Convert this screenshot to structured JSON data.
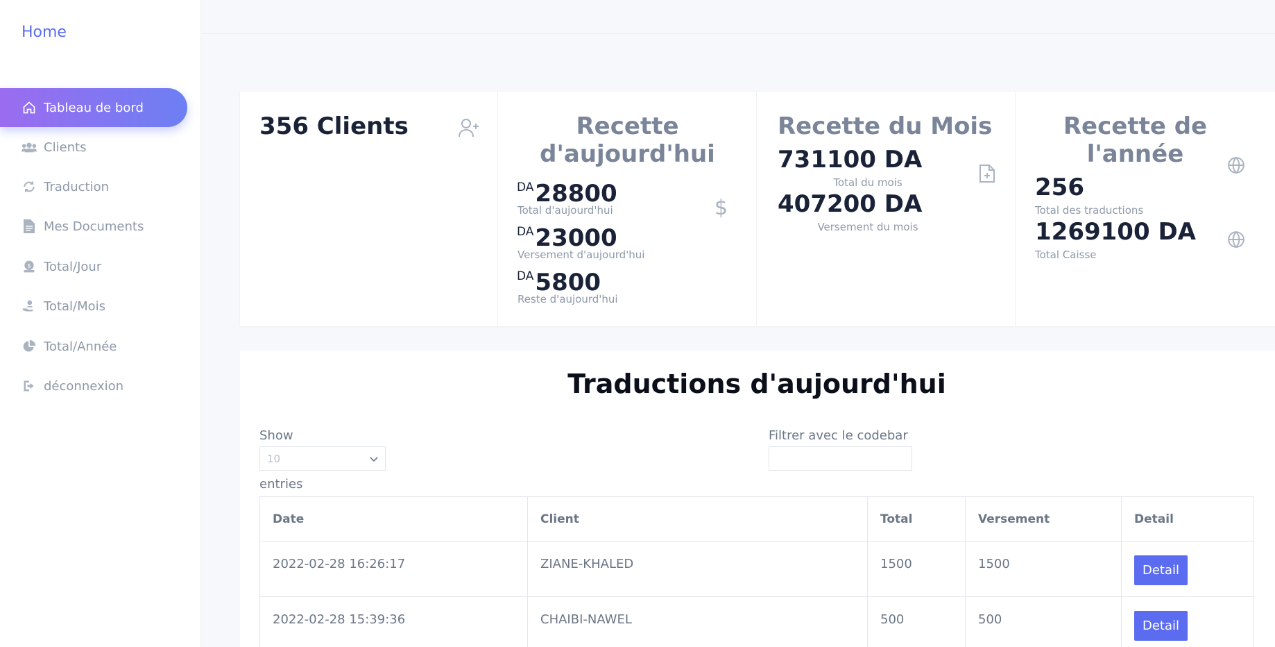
{
  "sidebar": {
    "brand": "Home",
    "items": [
      {
        "label": "Tableau de bord",
        "icon": "home-icon",
        "active": true
      },
      {
        "label": "Clients",
        "icon": "users-icon",
        "active": false
      },
      {
        "label": "Traduction",
        "icon": "refresh-icon",
        "active": false
      },
      {
        "label": "Mes Documents",
        "icon": "document-icon",
        "active": false
      },
      {
        "label": "Total/Jour",
        "icon": "money-icon",
        "active": false
      },
      {
        "label": "Total/Mois",
        "icon": "hand-coin-icon",
        "active": false
      },
      {
        "label": "Total/Année",
        "icon": "pie-chart-icon",
        "active": false
      },
      {
        "label": "déconnexion",
        "icon": "logout-icon",
        "active": false
      }
    ]
  },
  "stats": {
    "clients": {
      "title": "356 Clients",
      "icon": "user-plus-icon"
    },
    "today": {
      "title_line1": "Recette",
      "title_line2": "d'aujourd'hui",
      "currency": "DA",
      "total": "28800",
      "total_label": "Total d'aujourd'hui",
      "versement": "23000",
      "versement_label": "Versement d'aujourd'hui",
      "reste": "5800",
      "reste_label": "Reste d'aujourd'hui",
      "icon": "dollar-icon"
    },
    "month": {
      "title": "Recette du Mois",
      "total": "731100 DA",
      "total_label": "Total du mois",
      "versement": "407200 DA",
      "versement_label": "Versement du mois",
      "icon": "file-plus-icon"
    },
    "year": {
      "title_line1": "Recette de",
      "title_line2": "l'année",
      "traductions": "256",
      "traductions_label": "Total des traductions",
      "caisse": "1269100 DA",
      "caisse_label": "Total Caisse",
      "icon": "globe-icon"
    }
  },
  "table": {
    "title": "Traductions d'aujourd'hui",
    "show_label": "Show",
    "entries_value": "10",
    "entries_label": "entries",
    "filter_label": "Filtrer avec le codebar",
    "columns": [
      "Date",
      "Client",
      "Total",
      "Versement",
      "Detail"
    ],
    "rows": [
      {
        "date": "2022-02-28 16:26:17",
        "client": "ZIANE-KHALED",
        "total": "1500",
        "versement": "1500",
        "action": "Detail"
      },
      {
        "date": "2022-02-28 15:39:36",
        "client": "CHAIBI-NAWEL",
        "total": "500",
        "versement": "500",
        "action": "Detail"
      }
    ]
  },
  "colors": {
    "accent": "#5b6cf0",
    "gradient_start": "#9b6cf0",
    "gradient_end": "#6d7ff3"
  }
}
